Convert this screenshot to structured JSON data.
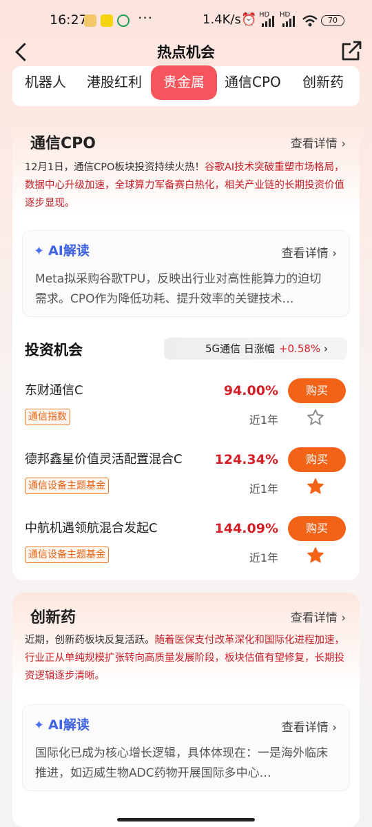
{
  "status": {
    "time": "16:27",
    "speed": "1.4K/s",
    "battery": "70",
    "net_label": "HD"
  },
  "header": {
    "title": "热点机会"
  },
  "tabs": [
    {
      "label": "机器人",
      "active": false
    },
    {
      "label": "港股红利",
      "active": false
    },
    {
      "label": "贵金属",
      "active": true
    },
    {
      "label": "通信CPO",
      "active": false
    },
    {
      "label": "创新药",
      "active": false
    }
  ],
  "sections": [
    {
      "title": "通信CPO",
      "more": "查看详情",
      "desc_plain": "12月1日，通信CPO板块投资持续火热！",
      "desc_red": "谷歌AI技术突破重塑市场格局，数据中心升级加速，全球算力军备赛白热化，相关产业链的长期投资价值逐步显现。",
      "ai": {
        "title": "AI解读",
        "more": "查看详情",
        "text": "Meta拟采购谷歌TPU，反映出行业对高性能算力的迫切需求。CPO作为降低功耗、提升效率的关键技术…"
      },
      "invest": {
        "title": "投资机会",
        "index_label": "5G通信 日涨幅",
        "index_change": "+0.58%",
        "funds": [
          {
            "name": "东财通信C",
            "tag": "通信指数",
            "return": "94.00%",
            "period": "近1年",
            "button": "购买",
            "starred": false
          },
          {
            "name": "德邦鑫星价值灵活配置混合C",
            "tag": "通信设备主题基金",
            "return": "124.34%",
            "period": "近1年",
            "button": "购买",
            "starred": true
          },
          {
            "name": "中航机遇领航混合发起C",
            "tag": "通信设备主题基金",
            "return": "144.09%",
            "period": "近1年",
            "button": "购买",
            "starred": true
          }
        ]
      }
    },
    {
      "title": "创新药",
      "more": "查看详情",
      "desc_plain": "近期，创新药板块反复活跃。",
      "desc_red": "随着医保支付改革深化和国际化进程加速，行业正从单纯规模扩张转向高质量发展阶段，板块估值有望修复，长期投资逻辑逐步清晰。",
      "ai": {
        "title": "AI解读",
        "more": "查看详情",
        "text": "国际化已成为核心增长逻辑，具体体现在：一是海外临床推进，如迈威生物ADC药物开展国际多中心…"
      }
    }
  ],
  "colors": {
    "accent": "#f5555c",
    "buy": "#f26318",
    "up": "#d41f27",
    "ai": "#3d62e3",
    "star": "#f26318"
  }
}
